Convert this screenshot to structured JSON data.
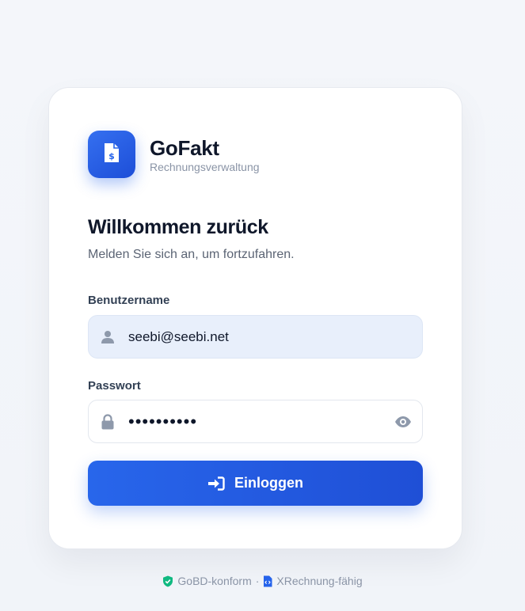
{
  "brand": {
    "name": "GoFakt",
    "subtitle": "Rechnungsverwaltung",
    "logo_icon": "invoice-dollar-icon"
  },
  "heading": {
    "title": "Willkommen zurück",
    "subtitle": "Melden Sie sich an, um fortzufahren."
  },
  "form": {
    "username": {
      "label": "Benutzername",
      "value": "seebi@seebi.net",
      "icon": "user-icon"
    },
    "password": {
      "label": "Passwort",
      "value": "••••••••••",
      "icon": "lock-icon",
      "toggle_icon": "eye-icon"
    },
    "submit": {
      "label": "Einloggen",
      "icon": "sign-in-icon"
    }
  },
  "footer": {
    "gobd": {
      "label": "GoBD-konform",
      "icon": "shield-check-icon"
    },
    "separator": "·",
    "xrechnung": {
      "label": "XRechnung-fähig",
      "icon": "file-code-icon"
    }
  },
  "colors": {
    "accent": "#2563eb",
    "text": "#0f172a",
    "muted": "#8a94a6",
    "shield": "#10b981"
  }
}
